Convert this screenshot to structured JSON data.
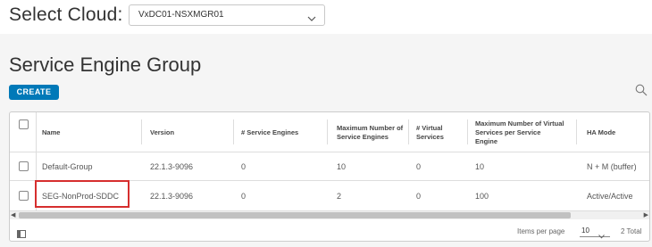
{
  "cloud_selector": {
    "label": "Select Cloud:",
    "value": "VxDC01-NSXMGR01"
  },
  "page": {
    "title": "Service Engine Group",
    "create_label": "CREATE"
  },
  "grid": {
    "headers": [
      "Name",
      "Version",
      "# Service Engines",
      "Maximum Number of Service Engines",
      "# Virtual Services",
      "Maximum Number of Virtual Services per Service Engine",
      "HA Mode"
    ],
    "rows": [
      {
        "name": "Default-Group",
        "version": "22.1.3-9096",
        "service_engines": "0",
        "max_service_engines": "10",
        "virtual_services": "0",
        "max_vs_per_se": "10",
        "ha_mode": "N + M (buffer)"
      },
      {
        "name": "SEG-NonProd-SDDC",
        "version": "22.1.3-9096",
        "service_engines": "0",
        "max_service_engines": "2",
        "virtual_services": "0",
        "max_vs_per_se": "100",
        "ha_mode": "Active/Active"
      }
    ],
    "footer": {
      "items_per_page_label": "Items per page",
      "items_per_page_value": "10",
      "total_label": "2 Total"
    }
  },
  "colors": {
    "accent": "#0079b8",
    "highlight": "#d62e2e",
    "background": "#f5f5f5"
  },
  "icons": [
    "chevron-down-icon",
    "search-icon",
    "column-toggle-icon",
    "scroll-left-icon",
    "scroll-right-icon"
  ]
}
